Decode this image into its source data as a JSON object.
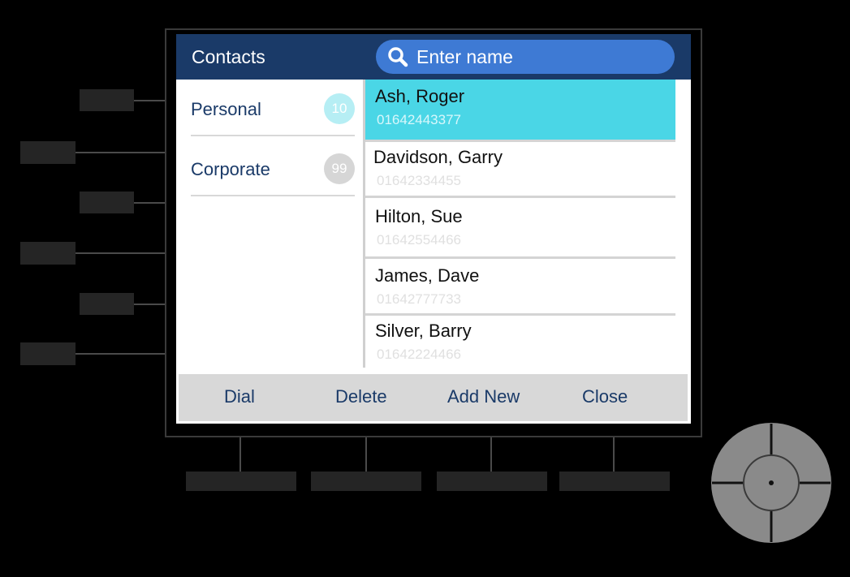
{
  "header": {
    "title": "Contacts",
    "search_placeholder": "Enter name"
  },
  "categories": [
    {
      "label": "Personal",
      "count": "10",
      "badge_color": "#b6eef4"
    },
    {
      "label": "Corporate",
      "count": "99",
      "badge_color": "#d6d6d6"
    }
  ],
  "contacts": [
    {
      "name": "Ash, Roger",
      "number": "01642443377",
      "selected": true
    },
    {
      "name": "Davidson, Garry",
      "number": "01642334455",
      "selected": false
    },
    {
      "name": "Hilton, Sue",
      "number": "01642554466",
      "selected": false
    },
    {
      "name": "James, Dave",
      "number": "01642777733",
      "selected": false
    },
    {
      "name": "Silver, Barry",
      "number": "01642224466",
      "selected": false
    }
  ],
  "softkeys": [
    "Dial",
    "Delete",
    "Add New",
    "Close"
  ],
  "icons": {
    "search": "search-icon",
    "nav_pad": "nav-pad"
  },
  "colors": {
    "header": "#1a3a68",
    "search": "#3e7ad4",
    "selected_row": "#4ad6e6",
    "softkey_bar": "#d8d8d8"
  }
}
